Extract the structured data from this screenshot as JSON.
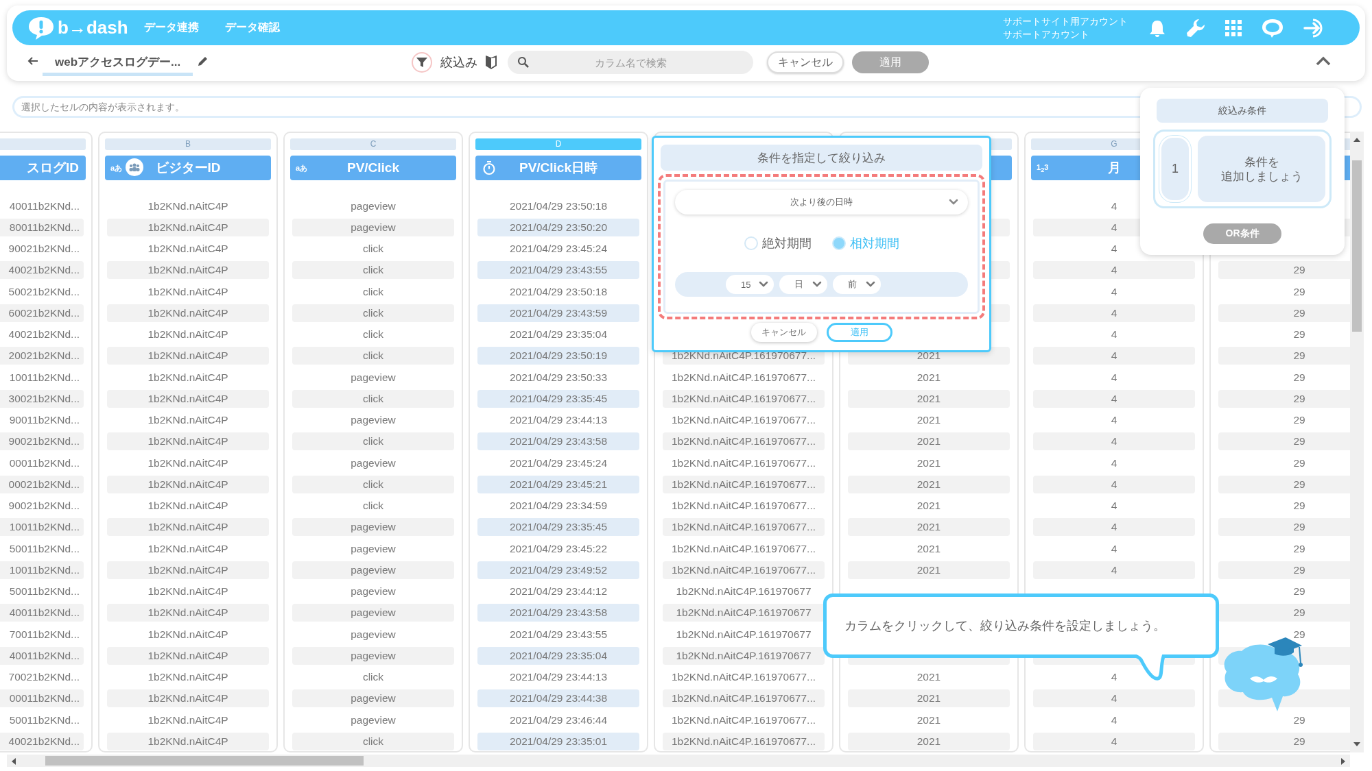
{
  "header": {
    "logo": "b→dash",
    "nav": [
      {
        "label": "データ連携"
      },
      {
        "label": "データ確認"
      }
    ],
    "account": [
      "サポートサイト用アカウント",
      "サポートアカウント"
    ]
  },
  "toolbar": {
    "title": "webアクセスログデー...",
    "filter_label": "絞込み",
    "search": {
      "placeholder": "カラム名で検索"
    },
    "buttons": [
      {
        "label": "キャンセル",
        "disabled": false
      },
      {
        "label": "適用",
        "disabled": true
      }
    ]
  },
  "cell_field": {
    "placeholder": "選択したセルの内容が表示されます。"
  },
  "table": {
    "columns": [
      {
        "title": "スログID",
        "selected": false
      },
      {
        "letter": "B",
        "title": "ビジターID",
        "type_label": "aあ",
        "selected": false
      },
      {
        "letter": "C",
        "title": "PV/Click",
        "type_label": "aあ",
        "selected": false
      },
      {
        "letter": "D",
        "title": "PV/Click日時",
        "selected": true
      },
      {},
      {},
      {
        "letter": "G",
        "title": "月",
        "type_label": "1$_{2}$3",
        "selected": false
      },
      {}
    ],
    "rows": [
      [
        "40011b2KNd...",
        "1b2KNd.nAitC4P",
        "pageview",
        "2021/04/29 23:50:18",
        null,
        null,
        "4",
        null
      ],
      [
        "80011b2KNd...",
        "1b2KNd.nAitC4P",
        "pageview",
        "2021/04/29 23:50:20",
        null,
        null,
        "4",
        null
      ],
      [
        "90021b2KNd...",
        "1b2KNd.nAitC4P",
        "click",
        "2021/04/29 23:45:24",
        null,
        null,
        "4",
        null
      ],
      [
        "40021b2KNd...",
        "1b2KNd.nAitC4P",
        "click",
        "2021/04/29 23:43:55",
        null,
        null,
        "4",
        "29"
      ],
      [
        "50021b2KNd...",
        "1b2KNd.nAitC4P",
        "click",
        "2021/04/29 23:50:18",
        null,
        null,
        "4",
        "29"
      ],
      [
        "60021b2KNd...",
        "1b2KNd.nAitC4P",
        "click",
        "2021/04/29 23:43:59",
        null,
        null,
        "4",
        "29"
      ],
      [
        "40021b2KNd...",
        "1b2KNd.nAitC4P",
        "click",
        "2021/04/29 23:35:04",
        null,
        null,
        "4",
        "29"
      ],
      [
        "20021b2KNd...",
        "1b2KNd.nAitC4P",
        "click",
        "2021/04/29 23:50:19",
        "1b2KNd.nAitC4P.161970677...",
        "2021",
        "4",
        "29"
      ],
      [
        "10011b2KNd...",
        "1b2KNd.nAitC4P",
        "pageview",
        "2021/04/29 23:50:33",
        "1b2KNd.nAitC4P.161970677...",
        "2021",
        "4",
        "29"
      ],
      [
        "30021b2KNd...",
        "1b2KNd.nAitC4P",
        "click",
        "2021/04/29 23:35:45",
        "1b2KNd.nAitC4P.161970677...",
        "2021",
        "4",
        "29"
      ],
      [
        "90011b2KNd...",
        "1b2KNd.nAitC4P",
        "pageview",
        "2021/04/29 23:44:13",
        "1b2KNd.nAitC4P.161970677...",
        "2021",
        "4",
        "29"
      ],
      [
        "90021b2KNd...",
        "1b2KNd.nAitC4P",
        "click",
        "2021/04/29 23:43:58",
        "1b2KNd.nAitC4P.161970677...",
        "2021",
        "4",
        "29"
      ],
      [
        "00011b2KNd...",
        "1b2KNd.nAitC4P",
        "pageview",
        "2021/04/29 23:45:24",
        "1b2KNd.nAitC4P.161970677...",
        "2021",
        "4",
        "29"
      ],
      [
        "00021b2KNd...",
        "1b2KNd.nAitC4P",
        "click",
        "2021/04/29 23:45:21",
        "1b2KNd.nAitC4P.161970677...",
        "2021",
        "4",
        "29"
      ],
      [
        "90021b2KNd...",
        "1b2KNd.nAitC4P",
        "click",
        "2021/04/29 23:34:59",
        "1b2KNd.nAitC4P.161970677...",
        "2021",
        "4",
        "29"
      ],
      [
        "10011b2KNd...",
        "1b2KNd.nAitC4P",
        "pageview",
        "2021/04/29 23:35:45",
        "1b2KNd.nAitC4P.161970677...",
        "2021",
        "4",
        "29"
      ],
      [
        "50011b2KNd...",
        "1b2KNd.nAitC4P",
        "pageview",
        "2021/04/29 23:45:22",
        "1b2KNd.nAitC4P.161970677...",
        "2021",
        "4",
        "29"
      ],
      [
        "10011b2KNd...",
        "1b2KNd.nAitC4P",
        "pageview",
        "2021/04/29 23:49:52",
        "1b2KNd.nAitC4P.161970677...",
        "2021",
        "4",
        "29"
      ],
      [
        "50011b2KNd...",
        "1b2KNd.nAitC4P",
        "pageview",
        "2021/04/29 23:44:12",
        "1b2KNd.nAitC4P.161970677",
        null,
        null,
        "29"
      ],
      [
        "40011b2KNd...",
        "1b2KNd.nAitC4P",
        "pageview",
        "2021/04/29 23:43:58",
        "1b2KNd.nAitC4P.161970677",
        null,
        null,
        "29"
      ],
      [
        "70011b2KNd...",
        "1b2KNd.nAitC4P",
        "pageview",
        "2021/04/29 23:43:55",
        "1b2KNd.nAitC4P.161970677",
        null,
        null,
        "29"
      ],
      [
        "40011b2KNd...",
        "1b2KNd.nAitC4P",
        "pageview",
        "2021/04/29 23:35:04",
        "1b2KNd.nAitC4P.161970677",
        null,
        null,
        null
      ],
      [
        "70021b2KNd...",
        "1b2KNd.nAitC4P",
        "click",
        "2021/04/29 23:44:13",
        "1b2KNd.nAitC4P.161970677...",
        "2021",
        "4",
        null
      ],
      [
        "00011b2KNd...",
        "1b2KNd.nAitC4P",
        "pageview",
        "2021/04/29 23:44:38",
        "1b2KNd.nAitC4P.161970677...",
        "2021",
        "4",
        null
      ],
      [
        "50011b2KNd...",
        "1b2KNd.nAitC4P",
        "pageview",
        "2021/04/29 23:46:44",
        "1b2KNd.nAitC4P.161970677...",
        "2021",
        "4",
        "29"
      ],
      [
        "40021b2KNd...",
        "1b2KNd.nAitC4P",
        "click",
        "2021/04/29 23:35:01",
        "1b2KNd.nAitC4P.161970677...",
        "2021",
        "4",
        "29"
      ]
    ]
  },
  "filter_popup": {
    "title": "条件を指定して絞り込み",
    "condition": {
      "value": "次より後の日時"
    },
    "period_options": [
      {
        "label": "絶対期間",
        "selected": false
      },
      {
        "label": "相対期間",
        "selected": true
      }
    ],
    "relative": [
      {
        "value": "15"
      },
      {
        "value": "日"
      },
      {
        "value": "前"
      }
    ],
    "buttons": [
      {
        "label": "キャンセル",
        "kind": "secondary"
      },
      {
        "label": "適用",
        "kind": "primary"
      }
    ]
  },
  "conditions_panel": {
    "title": "絞込み条件",
    "conditions": [
      {
        "number": "1",
        "lines": [
          "条件を",
          "追加しましょう"
        ]
      }
    ],
    "or_button": {
      "label": "OR条件",
      "disabled": true
    }
  },
  "hint": {
    "text": "カラムをクリックして、絞り込み条件を設定しましょう。"
  }
}
